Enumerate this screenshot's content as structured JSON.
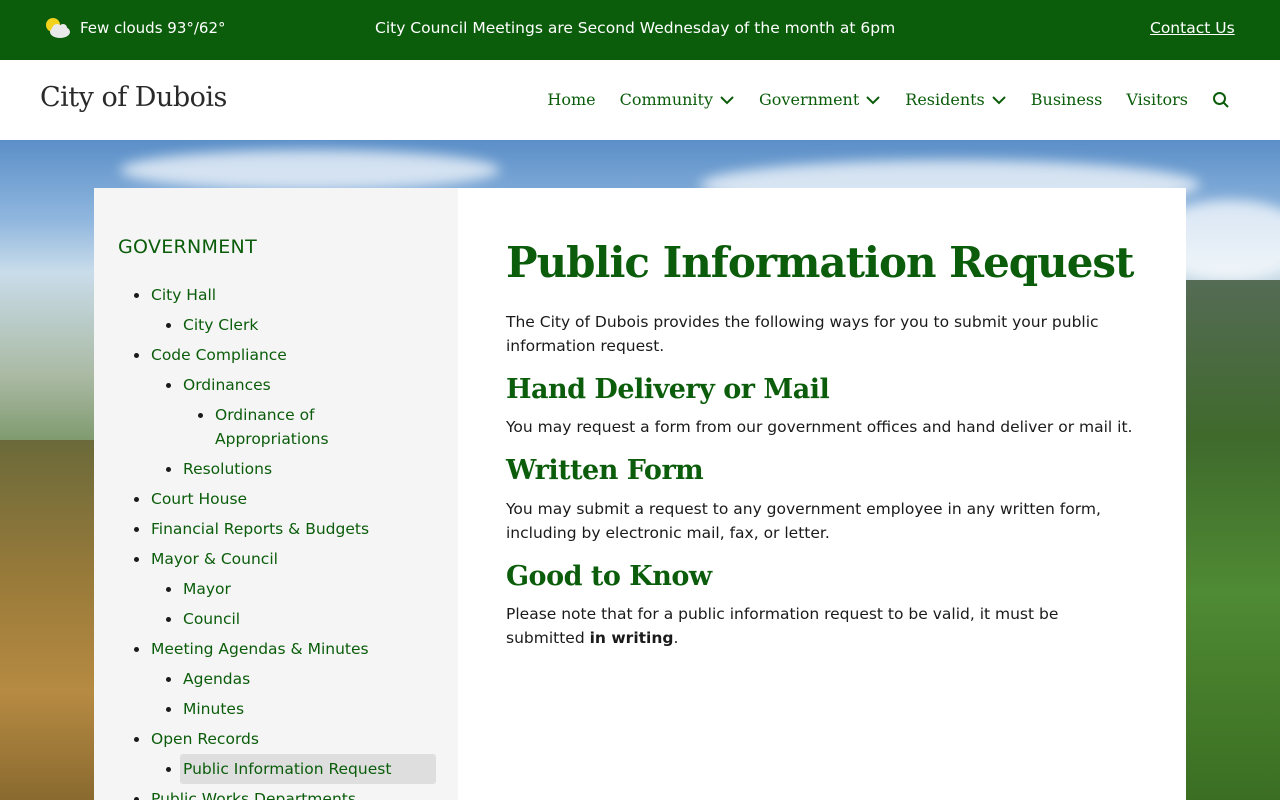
{
  "topbar": {
    "weather_text": "Few clouds 93°/62°",
    "announcement": "City Council Meetings are Second Wednesday of the month at 6pm",
    "contact_label": "Contact Us"
  },
  "header": {
    "site_title": "City of Dubois",
    "nav": [
      {
        "label": "Home",
        "dropdown": false
      },
      {
        "label": "Community",
        "dropdown": true
      },
      {
        "label": "Government",
        "dropdown": true
      },
      {
        "label": "Residents",
        "dropdown": true
      },
      {
        "label": "Business",
        "dropdown": false
      },
      {
        "label": "Visitors",
        "dropdown": false
      }
    ]
  },
  "sidebar": {
    "heading": "GOVERNMENT",
    "items": [
      {
        "label": "City Hall",
        "level": 1
      },
      {
        "label": "City Clerk",
        "level": 2
      },
      {
        "label": "Code Compliance",
        "level": 1
      },
      {
        "label": "Ordinances",
        "level": 2
      },
      {
        "label": "Ordinance of Appropriations",
        "level": 3
      },
      {
        "label": "Resolutions",
        "level": 2
      },
      {
        "label": "Court House",
        "level": 1
      },
      {
        "label": "Financial Reports & Budgets",
        "level": 1
      },
      {
        "label": "Mayor & Council",
        "level": 1
      },
      {
        "label": "Mayor",
        "level": 2
      },
      {
        "label": "Council",
        "level": 2
      },
      {
        "label": "Meeting Agendas & Minutes",
        "level": 1
      },
      {
        "label": "Agendas",
        "level": 2
      },
      {
        "label": "Minutes",
        "level": 2
      },
      {
        "label": "Open Records",
        "level": 1
      },
      {
        "label": "Public Information Request",
        "level": 2,
        "active": true
      },
      {
        "label": "Public Works Departments",
        "level": 1
      }
    ]
  },
  "main": {
    "title": "Public Information Request",
    "intro": "The City of Dubois provides the following ways for you to submit your public information request.",
    "sections": [
      {
        "heading": "Hand Delivery or Mail",
        "text": "You may request a form from our government offices and hand deliver or mail it."
      },
      {
        "heading": "Written Form",
        "text": "You may submit a request to any government employee in any written form, including by electronic mail, fax, or letter."
      },
      {
        "heading": "Good to Know",
        "text_before": "Please note that for a public information request to be valid, it must be submitted ",
        "text_bold": "in writing",
        "text_after": "."
      }
    ]
  },
  "colors": {
    "brand_green": "#0b5d0b",
    "sidebar_bg": "#f5f5f5",
    "active_bg": "#dedede"
  }
}
